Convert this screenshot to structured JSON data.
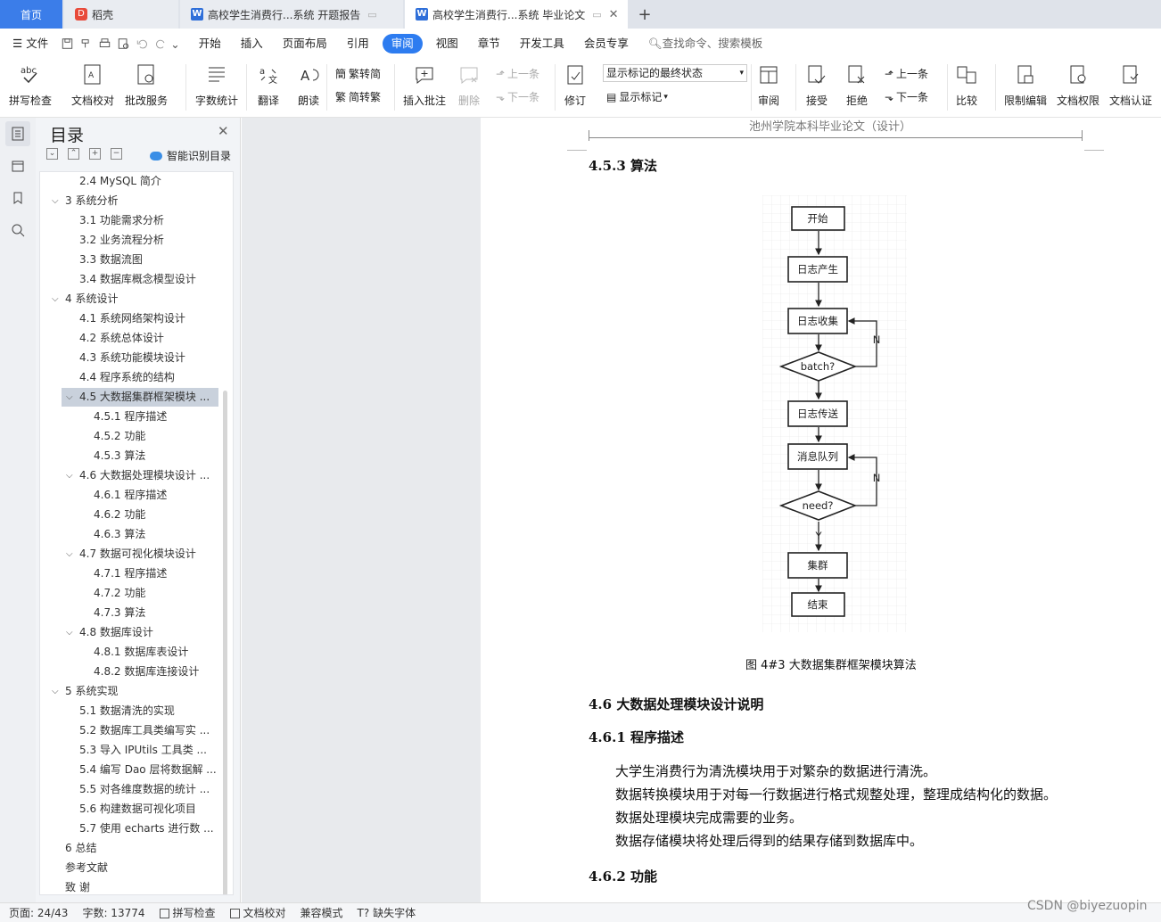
{
  "tabs": {
    "home": "首页",
    "daoke": "稻壳",
    "doc1": "高校学生消费行...系统 开题报告",
    "doc2": "高校学生消费行...系统 毕业论文",
    "plus": "+"
  },
  "menu": {
    "file": "文件",
    "items": [
      "开始",
      "插入",
      "页面布局",
      "引用",
      "审阅",
      "视图",
      "章节",
      "开发工具",
      "会员专享"
    ],
    "active": "审阅",
    "search": "查找命令、搜索模板"
  },
  "ribbon": {
    "spell": "拼写检查",
    "proof": "文档校对",
    "batch": "批改服务",
    "wordcount": "字数统计",
    "translate": "翻译",
    "read": "朗读",
    "trad": "繁转简",
    "simp": "简转繁",
    "comment": "插入批注",
    "delete": "删除",
    "prev": "上一条",
    "next": "下一条",
    "markup_select": "显示标记的最终状态",
    "show_markup": "显示标记",
    "revise": "修订",
    "review": "审阅",
    "accept": "接受",
    "reject": "拒绝",
    "prev2": "上一条",
    "next2": "下一条",
    "compare": "比较",
    "restrict": "限制编辑",
    "perm": "文档权限",
    "auth": "文档认证"
  },
  "toc": {
    "title": "目录",
    "smart": "智能识别目录",
    "items": [
      {
        "label": "2.4 MySQL 简介",
        "level": 2,
        "chev": ""
      },
      {
        "label": "3  系统分析",
        "level": 1,
        "chev": "v"
      },
      {
        "label": "3.1  功能需求分析",
        "level": 2,
        "chev": ""
      },
      {
        "label": "3.2  业务流程分析",
        "level": 2,
        "chev": ""
      },
      {
        "label": "3.3  数据流图",
        "level": 2,
        "chev": ""
      },
      {
        "label": "3.4  数据库概念模型设计",
        "level": 2,
        "chev": ""
      },
      {
        "label": "4  系统设计",
        "level": 1,
        "chev": "v"
      },
      {
        "label": "4.1  系统网络架构设计",
        "level": 2,
        "chev": ""
      },
      {
        "label": "4.2  系统总体设计",
        "level": 2,
        "chev": ""
      },
      {
        "label": "4.3  系统功能模块设计",
        "level": 2,
        "chev": ""
      },
      {
        "label": "4.4  程序系统的结构",
        "level": 2,
        "chev": ""
      },
      {
        "label": "4.5  大数据集群框架模块 ...",
        "level": 2,
        "chev": "v",
        "selected": true
      },
      {
        "label": "4.5.1  程序描述",
        "level": 3,
        "chev": ""
      },
      {
        "label": "4.5.2  功能",
        "level": 3,
        "chev": ""
      },
      {
        "label": "4.5.3  算法",
        "level": 3,
        "chev": ""
      },
      {
        "label": "4.6  大数据处理模块设计 ...",
        "level": 2,
        "chev": "v"
      },
      {
        "label": "4.6.1  程序描述",
        "level": 3,
        "chev": ""
      },
      {
        "label": "4.6.2  功能",
        "level": 3,
        "chev": ""
      },
      {
        "label": "4.6.3  算法",
        "level": 3,
        "chev": ""
      },
      {
        "label": "4.7  数据可视化模块设计",
        "level": 2,
        "chev": "v"
      },
      {
        "label": "4.7.1  程序描述",
        "level": 3,
        "chev": ""
      },
      {
        "label": "4.7.2  功能",
        "level": 3,
        "chev": ""
      },
      {
        "label": "4.7.3  算法",
        "level": 3,
        "chev": ""
      },
      {
        "label": "4.8  数据库设计",
        "level": 2,
        "chev": "v"
      },
      {
        "label": "4.8.1  数据库表设计",
        "level": 3,
        "chev": ""
      },
      {
        "label": "4.8.2  数据库连接设计",
        "level": 3,
        "chev": ""
      },
      {
        "label": "5  系统实现",
        "level": 1,
        "chev": "v"
      },
      {
        "label": "5.1  数据清洗的实现",
        "level": 2,
        "chev": ""
      },
      {
        "label": "5.2  数据库工具类编写实 ...",
        "level": 2,
        "chev": ""
      },
      {
        "label": "5.3 导入 IPUtils 工具类 ...",
        "level": 2,
        "chev": ""
      },
      {
        "label": "5.4 编写 Dao 层将数据解 ...",
        "level": 2,
        "chev": ""
      },
      {
        "label": "5.5  对各维度数据的统计 ...",
        "level": 2,
        "chev": ""
      },
      {
        "label": "5.6  构建数据可视化项目",
        "level": 2,
        "chev": ""
      },
      {
        "label": "5.7  使用 echarts 进行数 ...",
        "level": 2,
        "chev": ""
      },
      {
        "label": "6  总结",
        "level": 1,
        "chev": ""
      },
      {
        "label": "参考文献",
        "level": 1,
        "chev": ""
      },
      {
        "label": "致    谢",
        "level": 1,
        "chev": ""
      }
    ]
  },
  "doc": {
    "header": "池州学院本科毕业论文（设计）",
    "h453": "4.5.3  算法",
    "caption": "图 4#3  大数据集群框架模块算法",
    "h46": "4.6  大数据处理模块设计说明",
    "h461": "4.6.1  程序描述",
    "paras": [
      "大学生消费行为清洗模块用于对繁杂的数据进行清洗。",
      "数据转换模块用于对每一行数据进行格式规整处理，整理成结构化的数据。",
      "数据处理模块完成需要的业务。",
      "数据存储模块将处理后得到的结果存储到数据库中。"
    ],
    "h462": "4.6.2  功能",
    "flow": {
      "start": "开始",
      "log_gen": "日志产生",
      "log_collect": "日志收集",
      "batch": "batch?",
      "n1": "N",
      "log_send": "日志传送",
      "queue": "消息队列",
      "need": "need?",
      "n2": "N",
      "y": "Y",
      "cluster": "集群",
      "end": "结束"
    }
  },
  "status": {
    "page": "页面: 24/43",
    "words": "字数: 13774",
    "spell": "拼写检查",
    "proof": "文档校对",
    "compat": "兼容模式",
    "font": "缺失字体"
  },
  "watermark": "CSDN @biyezuopin"
}
